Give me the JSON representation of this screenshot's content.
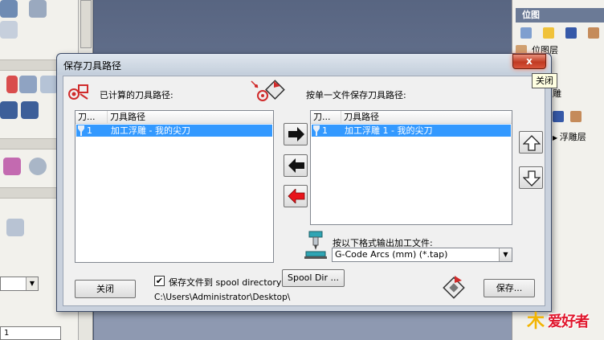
{
  "background": {
    "right_panel": {
      "header1": "位图",
      "layer_row": "位图层",
      "partial_row": "雕",
      "relief_layer": "浮雕层"
    },
    "left_panel": {
      "field_value": "1"
    }
  },
  "tooltip": "关闭",
  "dialog": {
    "title": "保存刀具路径",
    "close_glyph": "x",
    "computed_label": "已计算的刀具路径:",
    "single_file_label": "按单一文件保存刀具路径:",
    "left_list": {
      "columns": [
        "刀...",
        "刀具路径"
      ],
      "rows": [
        {
          "id": "1",
          "name": "加工浮雕 - 我的尖刀"
        }
      ]
    },
    "right_list": {
      "columns": [
        "刀...",
        "刀具路径"
      ],
      "rows": [
        {
          "id": "1",
          "name": "加工浮雕 1 - 我的尖刀"
        }
      ]
    },
    "format_label": "按以下格式输出加工文件:",
    "format_value": "G-Code Arcs (mm) (*.tap)",
    "close_button": "关闭",
    "spool_checkbox_label": "保存文件到 spool directory",
    "spool_checked": "✔",
    "spool_dir_button": "Spool Dir ...",
    "spool_path": "C:\\Users\\Administrator\\Desktop\\",
    "save_button": "保存..."
  },
  "watermark": {
    "mark": "木",
    "text": "爱好者"
  },
  "colors": {
    "selection": "#3399ff",
    "red_arrow": "#e8141b",
    "titlebar_close": "#c03a22",
    "accent_panel": "#6b7a96"
  }
}
